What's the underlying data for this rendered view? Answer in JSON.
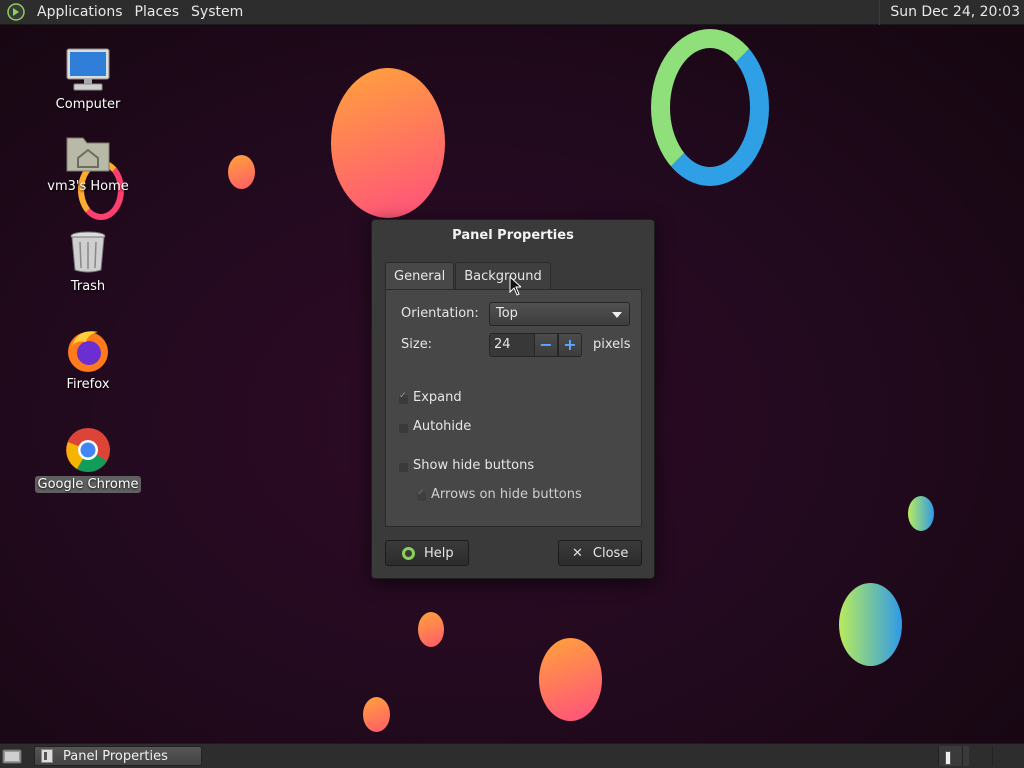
{
  "top_panel": {
    "menus": [
      "Applications",
      "Places",
      "System"
    ],
    "clock": "Sun Dec 24, 20:03"
  },
  "desktop_icons": [
    {
      "label": "Computer",
      "icon": "computer-icon"
    },
    {
      "label": "vm3's Home",
      "icon": "home-folder-icon"
    },
    {
      "label": "Trash",
      "icon": "trash-icon"
    },
    {
      "label": "Firefox",
      "icon": "firefox-icon"
    },
    {
      "label": "Google Chrome",
      "icon": "chrome-icon",
      "selected": true
    }
  ],
  "dialog": {
    "title": "Panel Properties",
    "tabs": [
      "General",
      "Background"
    ],
    "active_tab": "General",
    "orientation_label": "Orientation:",
    "orientation_value": "Top",
    "size_label": "Size:",
    "size_value": "24",
    "size_unit": "pixels",
    "checkboxes": [
      {
        "label": "Expand",
        "checked": true,
        "enabled": true
      },
      {
        "label": "Autohide",
        "checked": false,
        "enabled": true
      },
      {
        "label": "Show hide buttons",
        "checked": false,
        "enabled": true
      },
      {
        "label": "Arrows on hide buttons",
        "checked": true,
        "enabled": false
      }
    ],
    "help_label": "Help",
    "close_label": "Close"
  },
  "taskbar": {
    "task_label": "Panel Properties"
  },
  "colors": {
    "panel_bg": "#2d2d2d",
    "dialog_bg": "#3a3a3a",
    "desktop_bg": "#230a1f",
    "spin_accent": "#5aa8ff",
    "help_accent": "#8ccf5a"
  }
}
